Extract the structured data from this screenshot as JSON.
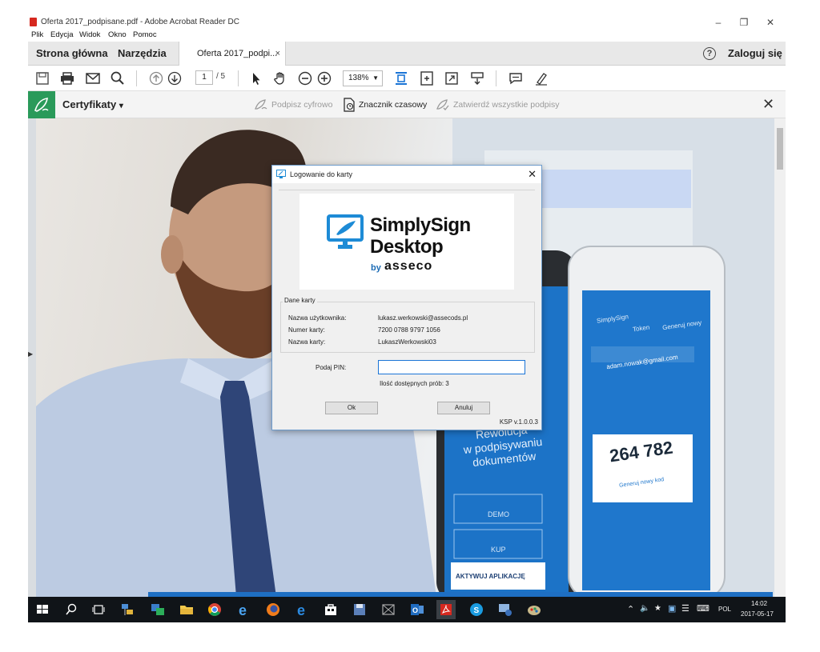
{
  "window": {
    "title": "Oferta 2017_podpisane.pdf - Adobe Acrobat Reader DC",
    "minimize": "–",
    "maximize": "❐",
    "close": "✕"
  },
  "menu": [
    "Plik",
    "Edycja",
    "Widok",
    "Okno",
    "Pomoc"
  ],
  "tabs": {
    "home": "Strona główna",
    "tools": "Narzędzia",
    "document": "Oferta 2017_podpi...",
    "document_close": "×",
    "help": "?",
    "login": "Zaloguj się"
  },
  "toolbar": {
    "page_current": "1",
    "page_total": "/ 5",
    "zoom": "138%"
  },
  "certificates": {
    "label": "Certyfikaty",
    "caret": "▾",
    "sign": "Podpisz cyfrowo",
    "timestamp": "Znacznik czasowy",
    "validate": "Zatwierdź wszystkie podpisy",
    "close": "✕"
  },
  "dialog": {
    "title": "Logowanie do karty",
    "close": "✕",
    "logo": {
      "name_line1": "SimplySign",
      "name_line2": "Desktop",
      "by": "by",
      "brand": "asseco"
    },
    "group_title": "Dane karty",
    "rows": [
      {
        "label": "Nazwa użytkownika:",
        "value": "lukasz.werkowski@assecods.pl"
      },
      {
        "label": "Numer karty:",
        "value": "7200 0788 9797 1056"
      },
      {
        "label": "Nazwa karty:",
        "value": "LukaszWerkowski03"
      }
    ],
    "pin_label": "Podaj PIN:",
    "pin_value": "",
    "attempts": "Ilość dostępnych prób: 3",
    "ok": "Ok",
    "cancel": "Anuluj",
    "version": "KSP v.1.0.0.3"
  },
  "background_phone": {
    "text_lines": [
      "Rewolucja",
      "w podpisywaniu",
      "dokumentów"
    ],
    "demo": "DEMO",
    "kup": "KUP",
    "activate": "AKTYWUJ APLIKACJĘ",
    "token": "264 782",
    "app_name": "SimplySign",
    "tab_token": "Token",
    "tab_generate": "Generuj nowy",
    "email": "adam.nowak@gmail.com",
    "generate_code": "Generuj nowy kod"
  },
  "taskbar": {
    "language": "POL",
    "time": "14:02",
    "date": "2017-05-17"
  },
  "colors": {
    "cert_green": "#2a9a5a",
    "taskbar_bg": "#101418",
    "brand_blue": "#1d6cb5",
    "pdf_red": "#d6281f"
  }
}
